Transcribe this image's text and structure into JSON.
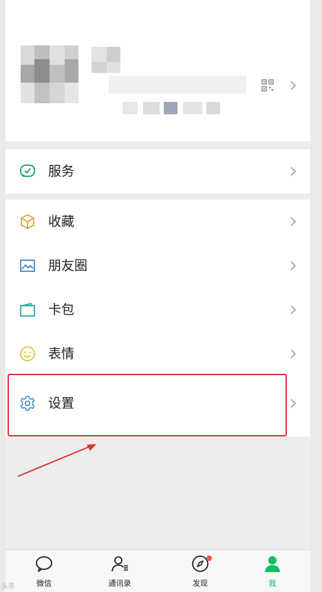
{
  "menu": {
    "services_label": "服务",
    "favorites_label": "收藏",
    "moments_label": "朋友圈",
    "cards_label": "卡包",
    "stickers_label": "表情",
    "settings_label": "设置"
  },
  "tabbar": {
    "chats_label": "微信",
    "contacts_label": "通讯录",
    "discover_label": "发现",
    "me_label": "我"
  },
  "watermark": "头条",
  "colors": {
    "accent": "#07c160",
    "highlight": "#d8373a",
    "badge": "#fa5151",
    "background": "#ededed"
  }
}
